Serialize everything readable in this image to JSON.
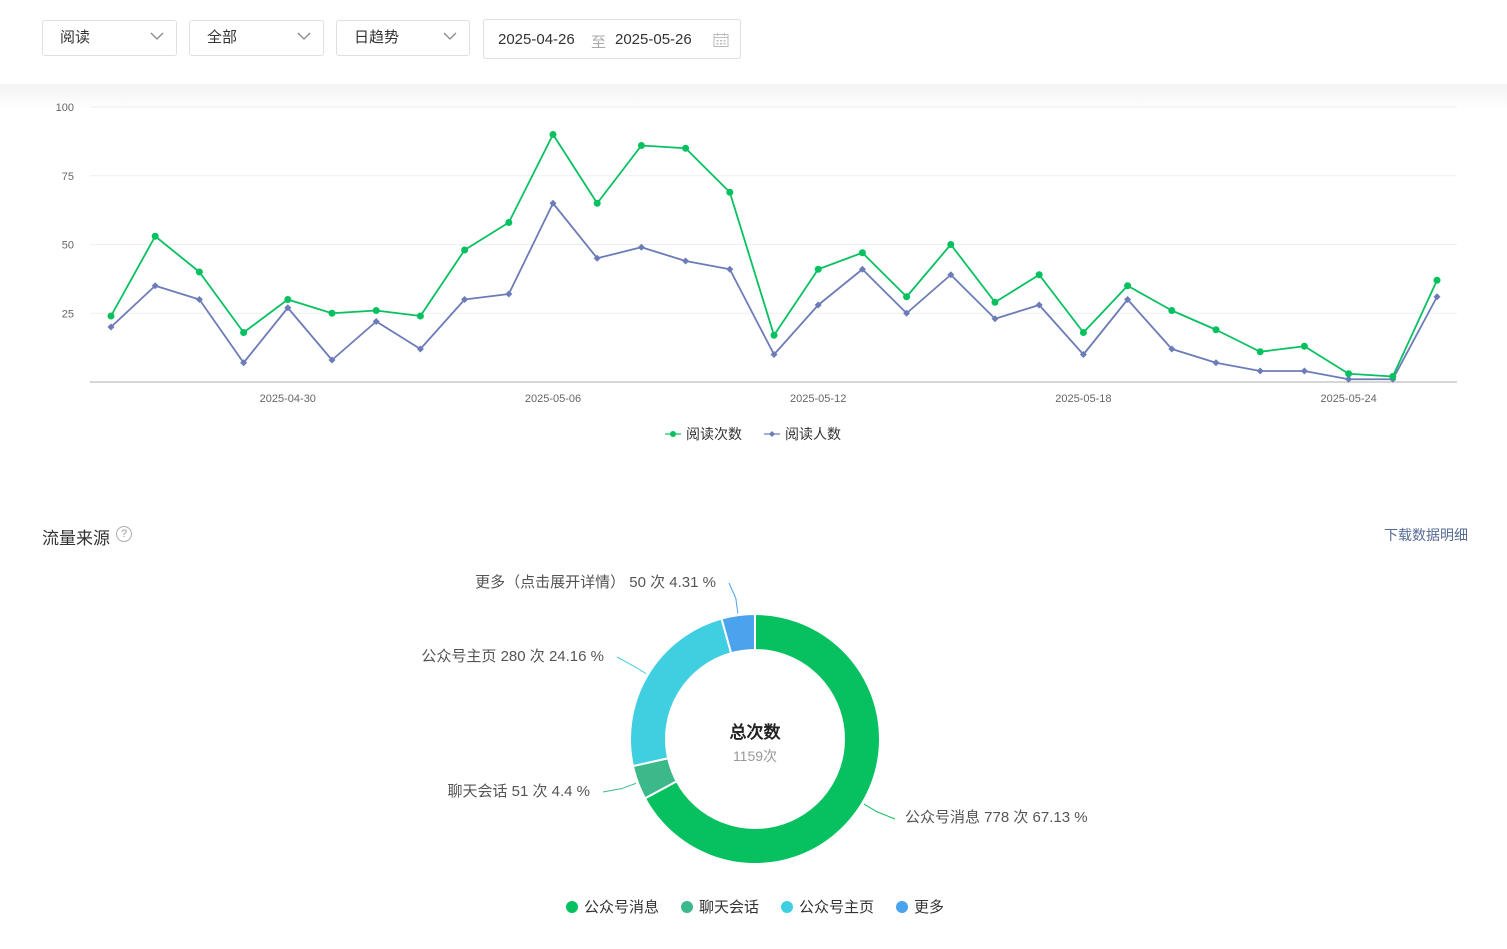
{
  "filters": {
    "metric": "阅读",
    "scope": "全部",
    "granularity": "日趋势",
    "date_start": "2025-04-26",
    "date_sep": "至",
    "date_end": "2025-05-26"
  },
  "chart_data": [
    {
      "type": "line",
      "y_ticks": [
        "25",
        "50",
        "75",
        "100"
      ],
      "ylim": [
        0,
        100
      ],
      "x_tick_labels": [
        "2025-04-30",
        "2025-05-06",
        "2025-05-12",
        "2025-05-18",
        "2025-05-24"
      ],
      "x": [
        "2025-04-26",
        "2025-04-27",
        "2025-04-28",
        "2025-04-29",
        "2025-04-30",
        "2025-05-01",
        "2025-05-02",
        "2025-05-03",
        "2025-05-04",
        "2025-05-05",
        "2025-05-06",
        "2025-05-07",
        "2025-05-08",
        "2025-05-09",
        "2025-05-10",
        "2025-05-11",
        "2025-05-12",
        "2025-05-13",
        "2025-05-14",
        "2025-05-15",
        "2025-05-16",
        "2025-05-17",
        "2025-05-18",
        "2025-05-19",
        "2025-05-20",
        "2025-05-21",
        "2025-05-22",
        "2025-05-23",
        "2025-05-24",
        "2025-05-25",
        "2025-05-26"
      ],
      "series": [
        {
          "name": "阅读次数",
          "color": "#07c160",
          "values": [
            24,
            53,
            40,
            18,
            30,
            25,
            26,
            24,
            48,
            58,
            90,
            65,
            86,
            85,
            69,
            17,
            41,
            47,
            31,
            50,
            29,
            39,
            18,
            35,
            26,
            19,
            11,
            13,
            3,
            2,
            37
          ]
        },
        {
          "name": "阅读人数",
          "color": "#6c7cb8",
          "values": [
            20,
            35,
            30,
            7,
            27,
            8,
            22,
            12,
            30,
            32,
            65,
            45,
            49,
            44,
            41,
            10,
            28,
            41,
            25,
            39,
            23,
            28,
            10,
            30,
            12,
            7,
            4,
            4,
            1,
            1,
            31
          ]
        }
      ],
      "grid": true,
      "legend": "bottom"
    },
    {
      "type": "pie",
      "center_title": "总次数",
      "center_value": "1159次",
      "slices": [
        {
          "name": "公众号消息",
          "value": 778,
          "percent": 67.13,
          "color": "#07c160",
          "label": "公众号消息 778 次 67.13 %"
        },
        {
          "name": "聊天会话",
          "value": 51,
          "percent": 4.4,
          "color": "#3cb98a",
          "label": "聊天会话 51 次 4.4 %"
        },
        {
          "name": "公众号主页",
          "value": 280,
          "percent": 24.16,
          "color": "#40cfe1",
          "label": "公众号主页 280 次 24.16 %"
        },
        {
          "name": "更多",
          "value": 50,
          "percent": 4.31,
          "color": "#4aa3ec",
          "label": "更多（点击展开详情） 50 次 4.31 %"
        }
      ],
      "legend": "bottom"
    }
  ],
  "traffic": {
    "title": "流量来源",
    "help": "?",
    "download": "下载数据明细"
  }
}
